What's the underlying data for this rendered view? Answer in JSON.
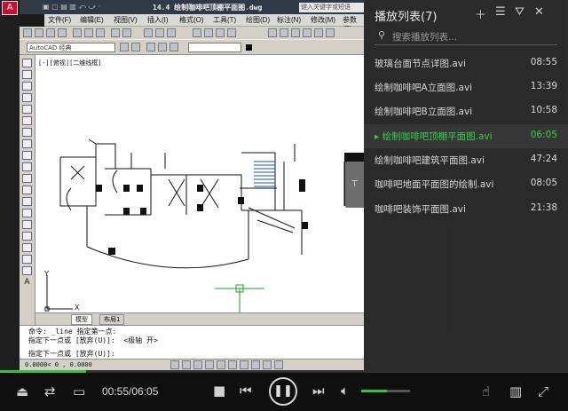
{
  "cad": {
    "title": "14.4  绘制咖啡吧顶棚平面图.dwg",
    "search_placeholder": "键入关键字或短语",
    "menus": [
      "文件(F)",
      "编辑(E)",
      "视图(V)",
      "插入(I)",
      "格式(O)",
      "工具(T)",
      "绘图(D)",
      "标注(N)",
      "修改(M)",
      "参数(P)"
    ],
    "workspace": "AutoCAD 经典",
    "viewport_label": "[-][俯视][二维线框]",
    "tabs": [
      "模型",
      "布局1"
    ],
    "command_lines": [
      "命令: _line 指定第一点:",
      "指定下一点或 [放弃(U)]:  <极轴 开>",
      "指定下一点或 [放弃(U)]:"
    ],
    "coords": "0.0000< 0   , 0.0000"
  },
  "playlist": {
    "title": "播放列表(7)",
    "search_placeholder": "搜索播放列表...",
    "collapse_icon": "pin-icon",
    "items": [
      {
        "name": "玻璃台面节点详图.avi",
        "duration": "08:55",
        "active": false
      },
      {
        "name": "绘制咖啡吧A立面图.avi",
        "duration": "13:39",
        "active": false
      },
      {
        "name": "绘制咖啡吧B立面图.avi",
        "duration": "10:58",
        "active": false
      },
      {
        "name": "绘制咖啡吧顶棚平面图.avi",
        "duration": "06:05",
        "active": true
      },
      {
        "name": "绘制咖啡吧建筑平面图.avi",
        "duration": "47:24",
        "active": false
      },
      {
        "name": "咖啡吧地面平面图的绘制.avi",
        "duration": "08:05",
        "active": false
      },
      {
        "name": "咖啡吧装饰平面图.avi",
        "duration": "21:38",
        "active": false
      }
    ]
  },
  "player": {
    "time": "00:55/06:05",
    "progress_fraction": 0.151,
    "volume_fraction": 0.53,
    "accent": "#35c23f"
  }
}
